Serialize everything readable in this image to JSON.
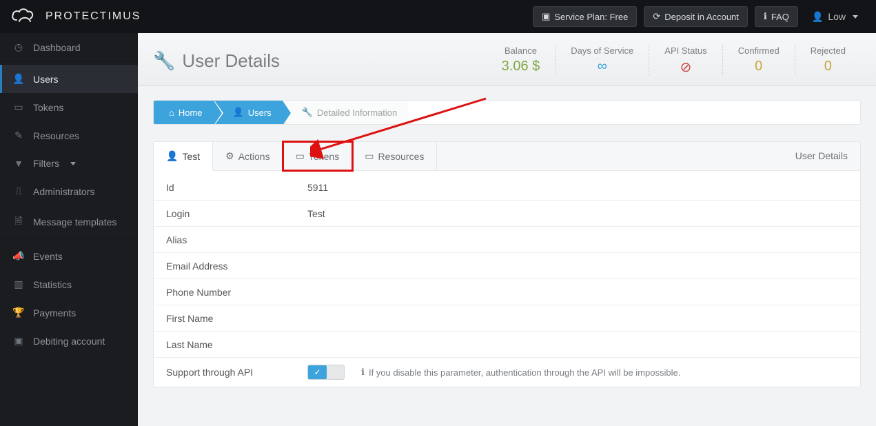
{
  "brand": "PROTECTIMUS",
  "topbar": {
    "service_plan": "Service Plan: Free",
    "deposit": "Deposit in Account",
    "faq": "FAQ",
    "username": "Low"
  },
  "sidebar": {
    "dashboard": "Dashboard",
    "users": "Users",
    "tokens": "Tokens",
    "resources": "Resources",
    "filters": "Filters",
    "administrators": "Administrators",
    "message_templates": "Message templates",
    "events": "Events",
    "statistics": "Statistics",
    "payments": "Payments",
    "debiting": "Debiting account"
  },
  "page": {
    "title": "User Details",
    "stats": {
      "balance_label": "Balance",
      "balance_value": "3.06 $",
      "days_label": "Days of Service",
      "days_value": "∞",
      "api_label": "API Status",
      "api_value": "⊘",
      "confirmed_label": "Confirmed",
      "confirmed_value": "0",
      "rejected_label": "Rejected",
      "rejected_value": "0"
    }
  },
  "breadcrumb": {
    "home": "Home",
    "users": "Users",
    "detail": "Detailed Information"
  },
  "tabs": {
    "test": "Test",
    "actions": "Actions",
    "tokens": "Tokens",
    "resources": "Resources",
    "right_label": "User Details"
  },
  "details": {
    "id_label": "Id",
    "id_value": "5911",
    "login_label": "Login",
    "login_value": "Test",
    "alias_label": "Alias",
    "alias_value": "",
    "email_label": "Email Address",
    "email_value": "",
    "phone_label": "Phone Number",
    "phone_value": "",
    "first_label": "First Name",
    "first_value": "",
    "last_label": "Last Name",
    "last_value": "",
    "api_label": "Support through API",
    "api_hint": "If you disable this parameter, authentication through the API will be impossible."
  }
}
